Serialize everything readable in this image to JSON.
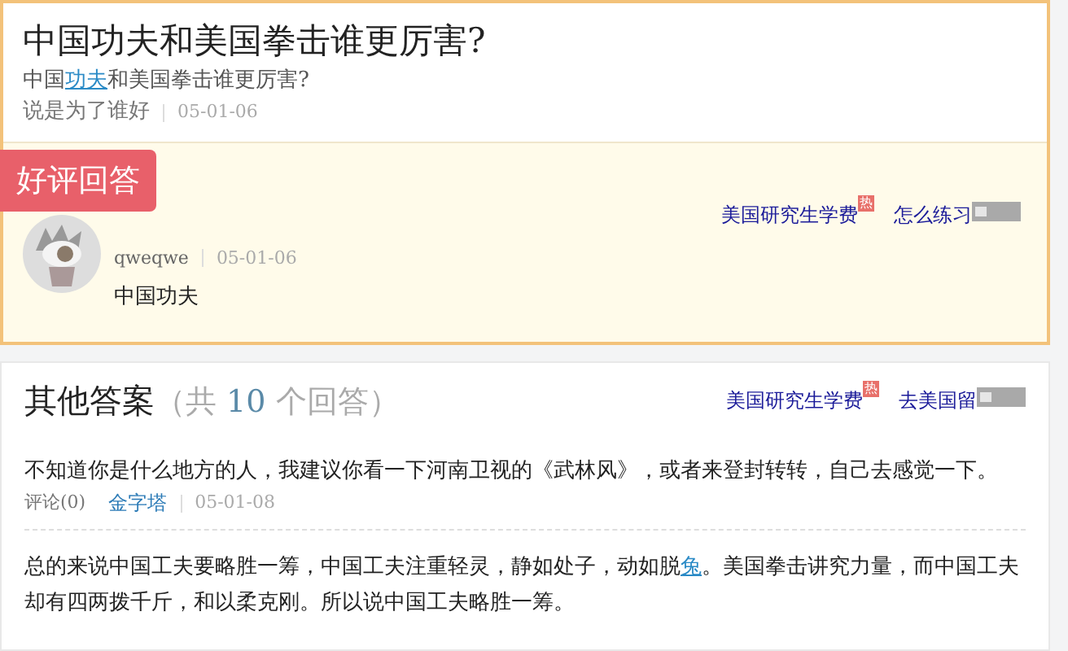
{
  "question": {
    "title": "中国功夫和美国拳击谁更厉害?",
    "detail": [
      {
        "text": "中国",
        "link": false
      },
      {
        "text": "功夫",
        "link": true
      },
      {
        "text": "和美国拳击谁更厉害?",
        "link": false
      }
    ],
    "asker": "说是为了谁好",
    "date": "05-01-06"
  },
  "best_answer": {
    "tag": "好评回答",
    "user": "qweqwe",
    "date": "05-01-06",
    "text": "中国功夫",
    "ad_links": [
      {
        "text": "美国研究生学费",
        "hot": "热",
        "ad_badge": false
      },
      {
        "text": "怎么练习",
        "ad_badge": true
      }
    ]
  },
  "other_answers": {
    "heading": "其他答案",
    "count_prefix": "（共 ",
    "count": "10",
    "count_suffix": " 个回答）",
    "ad_links": [
      {
        "text": "美国研究生学费",
        "hot": "热",
        "ad_badge": false
      },
      {
        "text": "去美国留",
        "ad_badge": true
      }
    ],
    "answers": [
      {
        "text": "不知道你是什么地方的人，我建议你看一下河南卫视的《武林风》，或者来登封转转，自己去感觉一下。",
        "comments": "评论(0)",
        "user": "金字塔",
        "date": "05-01-08"
      },
      {
        "text": [
          {
            "text": "总的来说中国工夫要略胜一筹，中国工夫注重轻灵，静如处子，动如脱",
            "link": false
          },
          {
            "text": "兔",
            "link": true
          },
          {
            "text": "。美国拳击讲究力量，而中国工夫却有四两拨千斤，和以柔克刚。所以说中国工夫略胜一筹。",
            "link": false
          }
        ]
      }
    ]
  }
}
